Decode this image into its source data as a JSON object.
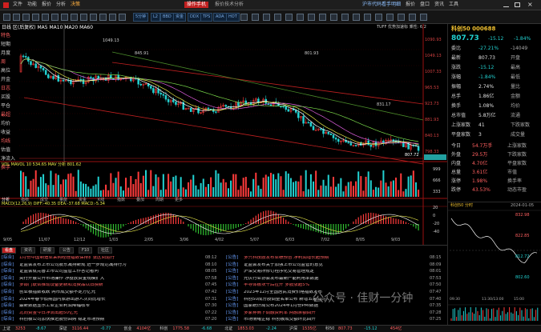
{
  "menu": {
    "items": [
      "文件",
      "功能",
      "报价",
      "分析",
      "决策"
    ],
    "center_title": "操作手机",
    "center_tab": "报价技术分析",
    "right_items": [
      "沪市代码看手明细",
      "报价",
      "盘口",
      "资讯",
      "工具"
    ]
  },
  "toolbar": {
    "buttons": [
      "5分钟",
      "L2",
      "BBD",
      "资金",
      "DDX",
      "TPS",
      "ADA",
      "HOT",
      "ELO"
    ]
  },
  "chart": {
    "top_line": "日线 区(后复权) MA5 MA10 MA20 MA60",
    "top_right_label": "TUFF 优势加速标 乘性: 6/2",
    "left_labels": [
      "特色",
      "短期",
      "月度",
      "周",
      "高位",
      "开金",
      "日志",
      "买股",
      "平仓",
      "最超",
      "均价",
      "收益",
      "均线",
      "估值",
      "净流入",
      "换手"
    ],
    "price_axis": [
      "1090.93",
      "1049.13",
      "1007.33",
      "965.53",
      "923.73",
      "881.93",
      "840.13",
      "798.33"
    ],
    "annotations": [
      "1049.13",
      "801.93",
      "807.72",
      "831.17",
      "845.91"
    ],
    "vol_label": "VOL MAVOL 10 534.65 MAV 分析 801.62",
    "vol_axis": [
      "999",
      "666",
      "333"
    ],
    "macd_label": "MACD(12,26,9) DIFF:-40.35 DEA:-37.68 MACD:-5.34",
    "macd_axis": [
      "20",
      "0",
      "-20",
      "-40"
    ],
    "bottom_tabs": [
      "分析",
      "指标",
      "成交",
      "量能",
      "资金",
      "K线",
      "指数",
      "叠加",
      "周期",
      "更多"
    ],
    "date_axis": [
      "9/05",
      "11/07",
      "12/12",
      "1/03",
      "2/05",
      "3/06",
      "4/02",
      "5/07",
      "6/03",
      "7/02",
      "8/05",
      "9/03"
    ]
  },
  "quote": {
    "title": "科创50 000688",
    "price": "807.73",
    "change": "-15.12",
    "change_pct": "-1.84%",
    "rows": [
      {
        "label": "委比",
        "value": "-27.21%",
        "extra": "-14049"
      },
      {
        "label": "最新",
        "value": "807.73",
        "extra": "开盘"
      },
      {
        "label": "涨跌",
        "value": "-15.12",
        "extra": "最高"
      },
      {
        "label": "涨幅",
        "value": "-1.84%",
        "extra": "最低"
      },
      {
        "label": "振幅",
        "value": "2.74%",
        "extra": "量比"
      },
      {
        "label": "总手",
        "value": "1.86亿",
        "extra": "金额"
      },
      {
        "label": "换手",
        "value": "1.08%",
        "extra": "均价"
      },
      {
        "label": "总市值",
        "value": "5.8万亿",
        "extra": "流通"
      },
      {
        "label": "上涨家数",
        "value": "41",
        "extra": "下跌家数"
      },
      {
        "label": "平盘家数",
        "value": "3",
        "extra": "成交量"
      }
    ],
    "lower_rows": [
      {
        "label": "今日",
        "value": "54.7万手",
        "extra": "上涨家数"
      },
      {
        "label": "外盘",
        "value": "29.5万",
        "extra": "下跌家数"
      },
      {
        "label": "内盘",
        "value": "4.70亿",
        "extra": "平盘家数"
      },
      {
        "label": "总量",
        "value": "3.61亿",
        "extra": "市值"
      },
      {
        "label": "涨停",
        "value": "1.98%",
        "extra": "换手率"
      },
      {
        "label": "跌停",
        "value": "43.53%",
        "extra": "动态市盈"
      }
    ],
    "mini_label": "科创50 分时",
    "mini_date": "2024-01-05",
    "mini_axis": [
      "832.98",
      "822.85",
      "812.72",
      "802.60"
    ],
    "mini_times": [
      "09:30",
      "11:30/13:00",
      "15:00"
    ]
  },
  "news": {
    "tabs": [
      "看盘",
      "资讯",
      "研报",
      "公告",
      "F10",
      "社区"
    ],
    "left": [
      {
        "tag": "[综合]",
        "text": "1月份中国制造业采购经理指数保持扩张区间运行",
        "time": "08:12"
      },
      {
        "tag": "[综合]",
        "text": "证监会发布上市公司股东减持新规 进一步规范减持行为",
        "time": "08:10"
      },
      {
        "tag": "[综合]",
        "text": "证监会就完善上市公司监管工作答记者问",
        "time": "08:05"
      },
      {
        "tag": "[综合]",
        "text": "央行开展公开市场操作 净投放资金规模扩大",
        "time": "07:58"
      },
      {
        "tag": "[综合]",
        "text": "多部门联合推动设备更新和消费品以旧换新",
        "time": "07:45"
      },
      {
        "tag": "[综合]",
        "text": "创业板指数收跌 两市成交额不足万亿元",
        "time": "07:42"
      },
      {
        "tag": "[综合]",
        "text": "2024年春节假期国内旅游出游人次同比增长",
        "time": "07:31"
      },
      {
        "tag": "[综合]",
        "text": "最新数据显示工业企业利润降幅收窄",
        "time": "07:30"
      },
      {
        "tag": "[综合]",
        "text": "北向资金今日净流出超50亿元",
        "time": "07:22"
      },
      {
        "tag": "[综合]",
        "text": "科创板公司加快推进股份回购 稳定市场预期",
        "time": "07:20"
      }
    ],
    "right": [
      {
        "tag": "[公告]",
        "text": "多只科技股发布业绩预告 净利润增长超预期",
        "time": "08:15"
      },
      {
        "tag": "[公告]",
        "text": "证监会发布关于加强上市公司监管的意见",
        "time": "08:09"
      },
      {
        "tag": "[公告]",
        "text": "沪深交易所修订程序化交易管理规定",
        "time": "08:01"
      },
      {
        "tag": "[公告]",
        "text": "光伏行业协会发布最新产能利用率数据",
        "time": "07:53"
      },
      {
        "tag": "[公告]",
        "text": "半导体板块午后拉升 多股涨超5%",
        "time": "07:50"
      },
      {
        "tag": "[公告]",
        "text": "2023年12月全国居民消费价格指数发布",
        "time": "07:47"
      },
      {
        "tag": "[公告]",
        "text": "科创50成分股调整名单公布 新增五家公司",
        "time": "07:40"
      },
      {
        "tag": "[公告]",
        "text": "国家统计局公布2024年1月份PMI数据",
        "time": "07:35"
      },
      {
        "tag": "[公告]",
        "text": "多家券商下调融资利率 两融余额回升",
        "time": "07:28"
      },
      {
        "tag": "[公告]",
        "text": "市场情绪企稳 科创板成交额环比回升",
        "time": "07:25"
      }
    ]
  },
  "status": [
    {
      "label": "上证",
      "value": "3253"
    },
    {
      "label": "",
      "value": "-8.67"
    },
    {
      "label": "深证",
      "value": "3116.44"
    },
    {
      "label": "",
      "value": "-0.77"
    },
    {
      "label": "创业",
      "value": "4104亿"
    },
    {
      "label": "科创",
      "value": "1775.58"
    },
    {
      "label": "",
      "value": "-6.68"
    },
    {
      "label": "北证",
      "value": "1853.03"
    },
    {
      "label": "",
      "value": "-2.24"
    },
    {
      "label": "沪深",
      "value": "1535亿"
    },
    {
      "label": "科50",
      "value": "807.73"
    },
    {
      "label": "",
      "value": "-15.12"
    },
    {
      "label": "",
      "value": "454亿"
    }
  ],
  "watermark": "公众号 · 佳财一分钟",
  "colors": {
    "up": "#ff3b3b",
    "down": "#22d2d2",
    "accent": "#f0c030",
    "ma_yellow": "#e8e84a",
    "ma_green": "#7ad84a",
    "ma_magenta": "#e060e0"
  }
}
